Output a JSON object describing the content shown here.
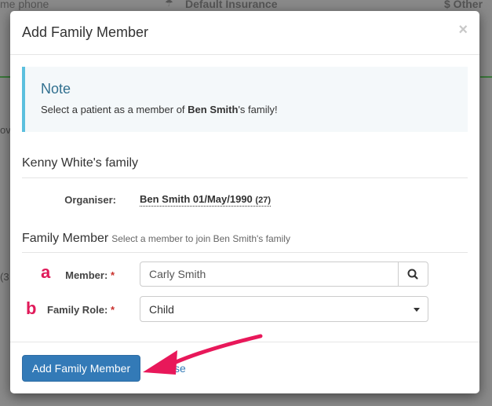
{
  "background": {
    "col1": "me phone",
    "col2": "Default Insurance",
    "col3": "$  Other",
    "frag_left_1": "ov",
    "frag_left_2": "(3"
  },
  "modal": {
    "title": "Add Family Member",
    "close_symbol": "×",
    "note": {
      "title": "Note",
      "text_prefix": "Select a patient as a member of ",
      "text_bold": "Ben Smith",
      "text_suffix": "'s family!"
    },
    "family_title": "Kenny White's family",
    "organiser": {
      "label": "Organiser:",
      "value": "Ben Smith 01/May/1990",
      "age": "(27)"
    },
    "family_member": {
      "title": "Family Member",
      "subtitle": "Select a member to join Ben Smith's family"
    },
    "member": {
      "marker": "a",
      "label": "Member:",
      "required": "*",
      "value": "Carly Smith"
    },
    "role": {
      "marker": "b",
      "label": "Family Role:",
      "required": "*",
      "selected": "Child"
    },
    "footer": {
      "add_button": "Add Family Member",
      "close_link": "Close"
    }
  },
  "colors": {
    "primary": "#337ab7",
    "note_border": "#5bc0de",
    "annotation": "#e01a5a"
  }
}
